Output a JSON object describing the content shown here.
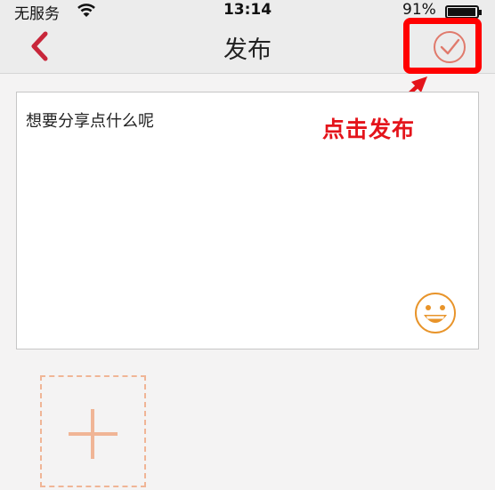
{
  "status_bar": {
    "carrier": "无服务",
    "time": "13:14",
    "battery": "91%"
  },
  "nav": {
    "title": "发布",
    "back_icon": "chevron-left-icon",
    "confirm_icon": "check-circle-icon"
  },
  "composer": {
    "placeholder": "想要分享点什么呢",
    "emoji_icon": "smiley-icon"
  },
  "annotation": {
    "text": "点击发布"
  },
  "media": {
    "add_icon": "plus-icon"
  },
  "colors": {
    "accent": "#c8263a",
    "annotation_red": "#e4141b",
    "emoji_orange": "#e8942a",
    "add_border": "#f0b596"
  }
}
